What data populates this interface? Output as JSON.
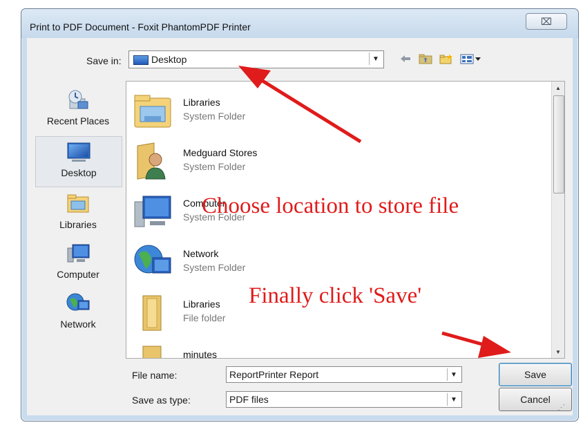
{
  "window": {
    "title": "Print to PDF Document - Foxit PhantomPDF Printer"
  },
  "toolbar": {
    "save_in_label": "Save in:",
    "location_value": "Desktop"
  },
  "places": [
    {
      "label": "Recent Places",
      "icon": "recent-places-icon",
      "selected": false
    },
    {
      "label": "Desktop",
      "icon": "desktop-icon",
      "selected": true
    },
    {
      "label": "Libraries",
      "icon": "libraries-icon",
      "selected": false
    },
    {
      "label": "Computer",
      "icon": "computer-icon",
      "selected": false
    },
    {
      "label": "Network",
      "icon": "network-icon",
      "selected": false
    }
  ],
  "files": [
    {
      "name": "Libraries",
      "type": "System Folder",
      "icon": "libraries-folder-icon"
    },
    {
      "name": "Medguard Stores",
      "type": "System Folder",
      "icon": "user-folder-icon"
    },
    {
      "name": "Computer",
      "type": "System Folder",
      "icon": "computer-icon"
    },
    {
      "name": "Network",
      "type": "System Folder",
      "icon": "network-icon"
    },
    {
      "name": "Libraries",
      "type": "File folder",
      "icon": "folder-icon"
    },
    {
      "name": "minutes",
      "type": "",
      "icon": "folder-icon"
    }
  ],
  "form": {
    "file_name_label": "File name:",
    "file_name_value": "ReportPrinter Report",
    "save_type_label": "Save as type:",
    "save_type_value": "PDF files"
  },
  "buttons": {
    "save": "Save",
    "cancel": "Cancel",
    "close": "⌧"
  },
  "annotations": {
    "location_note": "Choose location to store file",
    "save_note": "Finally click 'Save'",
    "color": "#e01b1b"
  }
}
